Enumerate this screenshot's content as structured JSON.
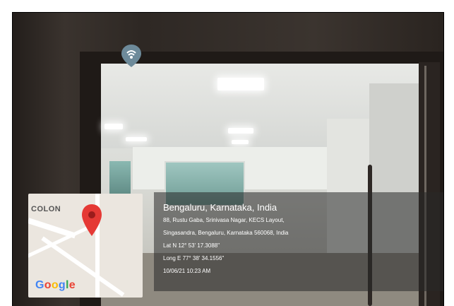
{
  "location": {
    "city": "Bengaluru, Karnataka, India",
    "address_line1": "88, Rustu Gaba, Srinivasa Nagar, KECS Layout,",
    "address_line2": "Singasandra, Bengaluru, Karnataka 560068, India",
    "latitude": "Lat N 12° 53' 17.3088\"",
    "longitude": "Long E 77° 38' 34.1556\"",
    "timestamp": "10/06/21 10:23 AM"
  },
  "map": {
    "area_label": "COLON",
    "brand": [
      "G",
      "o",
      "o",
      "g",
      "l",
      "e"
    ],
    "pin_color": "#e53935",
    "pin_icon": "location-pin-icon",
    "place_icon": "place-marker-icon"
  }
}
